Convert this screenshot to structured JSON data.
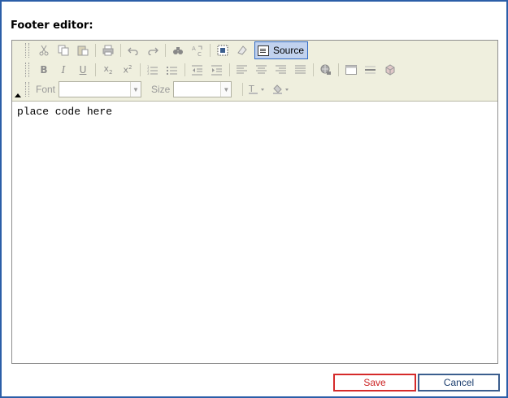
{
  "dialog": {
    "title": "Footer editor:"
  },
  "toolbar": {
    "source_label": "Source",
    "font_label": "Font",
    "size_label": "Size",
    "font_value": "",
    "size_value": ""
  },
  "editor": {
    "content": "place code here"
  },
  "actions": {
    "save_label": "Save",
    "cancel_label": "Cancel"
  },
  "colors": {
    "dialog_border": "#2b5ea8",
    "toolbar_bg": "#efefde",
    "save_border": "#d52a2a",
    "cancel_border": "#3b5e8e"
  }
}
